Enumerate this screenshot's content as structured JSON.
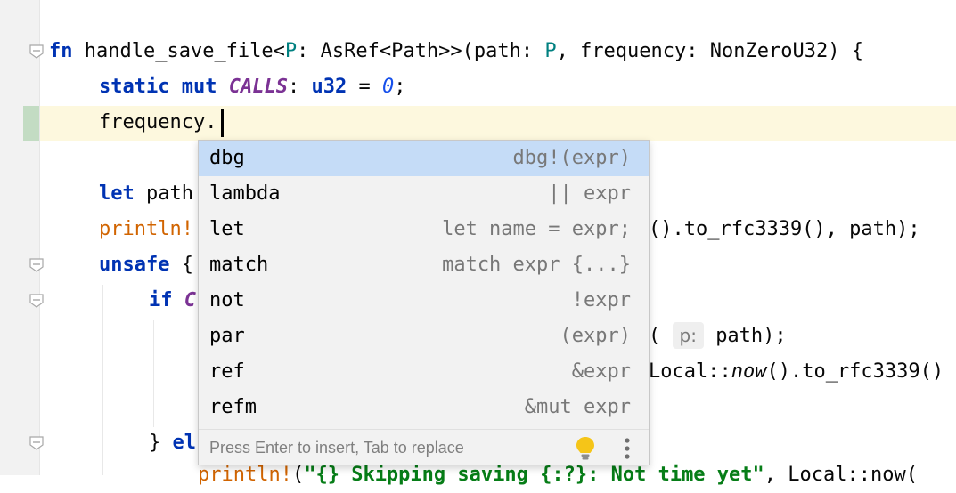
{
  "editor": {
    "line1": {
      "kw_fn": "fn",
      "name": " handle_save_file<",
      "tp1": "P",
      "mid1": ": AsRef<Path>>(path: ",
      "tp2": "P",
      "mid2": ", frequency: NonZeroU32) {"
    },
    "line2": {
      "kw1": "static",
      "kw2": "mut",
      "static_name": "CALLS",
      "colon": ": ",
      "type": "u32",
      "eq": " = ",
      "value": "0",
      "semi": ";"
    },
    "line3": {
      "text": "frequency."
    },
    "line5": {
      "kw": "let",
      "rest": " path"
    },
    "line6": {
      "macro": "println!",
      "tail": "().to_rfc3339(), path);"
    },
    "line7": {
      "kw": "unsafe",
      "rest": " {"
    },
    "line8": {
      "kw": "if",
      "static_frag": "C"
    },
    "line9": {
      "pre": "(",
      "hint_label": "p:",
      "post": "path);"
    },
    "line10": {
      "pre": "Local::",
      "italic": "now",
      "post": "().to_rfc3339()"
    },
    "line12": {
      "brace": "} ",
      "kw": "el"
    },
    "line13": {
      "macro": "println!",
      "paren": "(",
      "string": "\"{} Skipping saving {:?}: Not time yet\"",
      "tail": ", Local::now("
    }
  },
  "completion": {
    "items": [
      {
        "label": "dbg",
        "tail": "dbg!(expr)"
      },
      {
        "label": "lambda",
        "tail": "|| expr"
      },
      {
        "label": "let",
        "tail": "let name = expr;"
      },
      {
        "label": "match",
        "tail": "match expr {...}"
      },
      {
        "label": "not",
        "tail": "!expr"
      },
      {
        "label": "par",
        "tail": "(expr)"
      },
      {
        "label": "ref",
        "tail": "&expr"
      },
      {
        "label": "refm",
        "tail": "&mut expr"
      }
    ],
    "selected_index": 0,
    "footer_text": "Press Enter to insert, Tab to replace",
    "icons": [
      "lightbulb-icon",
      "more-options-icon"
    ]
  },
  "colors": {
    "keyword": "#0033b3",
    "type_param": "#008080",
    "static": "#7b3294",
    "number": "#1750eb",
    "macro": "#d16400",
    "string": "#067d17",
    "selection": "#c5dcf7",
    "current_line": "#fdf8de",
    "bulb": "#f5c518"
  }
}
